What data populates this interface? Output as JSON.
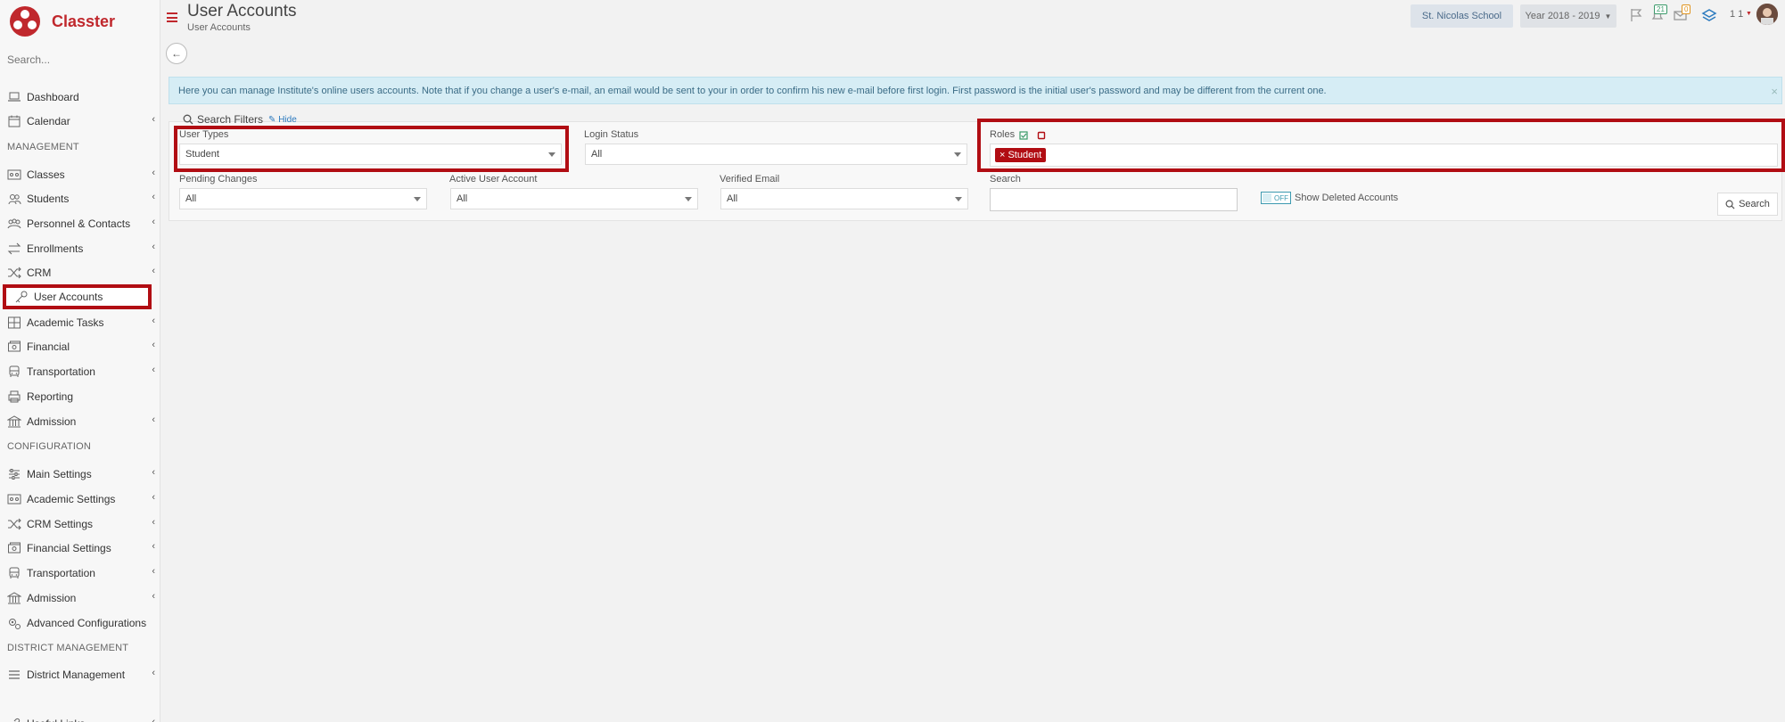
{
  "app": {
    "name": "Classter",
    "brand_color": "#c0282d",
    "highlight_color": "#b10d13"
  },
  "sidebar": {
    "search_placeholder": "Search...",
    "items": [
      {
        "label": "Dashboard",
        "icon": "laptop-icon",
        "chevron": false
      },
      {
        "label": "Calendar",
        "icon": "calendar-icon",
        "chevron": true
      },
      {
        "label": "MANAGEMENT",
        "section": true
      },
      {
        "label": "Classes",
        "icon": "classes-icon",
        "chevron": true
      },
      {
        "label": "Students",
        "icon": "students-icon",
        "chevron": true
      },
      {
        "label": "Personnel & Contacts",
        "icon": "personnel-icon",
        "chevron": true
      },
      {
        "label": "Enrollments",
        "icon": "exchange-icon",
        "chevron": true
      },
      {
        "label": "CRM",
        "icon": "shuffle-icon",
        "chevron": true
      },
      {
        "label": "User Accounts",
        "icon": "key-icon",
        "chevron": false,
        "active": true
      },
      {
        "label": "Academic Tasks",
        "icon": "table-icon",
        "chevron": true
      },
      {
        "label": "Financial",
        "icon": "money-icon",
        "chevron": true
      },
      {
        "label": "Transportation",
        "icon": "bus-icon",
        "chevron": true
      },
      {
        "label": "Reporting",
        "icon": "printer-icon",
        "chevron": false
      },
      {
        "label": "Admission",
        "icon": "building-icon",
        "chevron": true
      },
      {
        "label": "CONFIGURATION",
        "section": true
      },
      {
        "label": "Main Settings",
        "icon": "sliders-icon",
        "chevron": true
      },
      {
        "label": "Academic Settings",
        "icon": "classes-icon",
        "chevron": true
      },
      {
        "label": "CRM Settings",
        "icon": "shuffle-icon",
        "chevron": true
      },
      {
        "label": "Financial Settings",
        "icon": "money-icon",
        "chevron": true
      },
      {
        "label": "Transportation",
        "icon": "bus-icon",
        "chevron": true
      },
      {
        "label": "Admission",
        "icon": "building-icon",
        "chevron": true
      },
      {
        "label": "Advanced Configurations",
        "icon": "cogs-icon",
        "chevron": false
      },
      {
        "label": "DISTRICT MANAGEMENT",
        "section": true
      },
      {
        "label": "District Management",
        "icon": "list-icon",
        "chevron": true
      },
      {
        "label": "Useful Links",
        "icon": "link-icon",
        "chevron": true
      }
    ]
  },
  "header": {
    "title": "User Accounts",
    "subtitle": "User Accounts",
    "school": "St. Nicolas School",
    "year": "Year 2018 - 2019",
    "notifications_count": "21",
    "messages_count": "0",
    "user_counter": "1 1"
  },
  "info": {
    "text": "Here you can manage Institute's online users accounts. Note that if you change a user's e-mail, an email would be sent to your in order to confirm his new e-mail before first login. First password is the initial user's password and may be different from the current one."
  },
  "filters": {
    "heading": "Search Filters",
    "hide_label": "Hide",
    "user_types": {
      "label": "User Types",
      "value": "Student"
    },
    "login_status": {
      "label": "Login Status",
      "value": "All"
    },
    "roles": {
      "label": "Roles",
      "tag": "Student"
    },
    "pending_changes": {
      "label": "Pending Changes",
      "value": "All"
    },
    "active_user_account": {
      "label": "Active User Account",
      "value": "All"
    },
    "verified_email": {
      "label": "Verified Email",
      "value": "All"
    },
    "search": {
      "label": "Search",
      "value": ""
    },
    "show_deleted": {
      "label": "Show Deleted Accounts",
      "state": "OFF"
    },
    "search_button": "Search"
  }
}
